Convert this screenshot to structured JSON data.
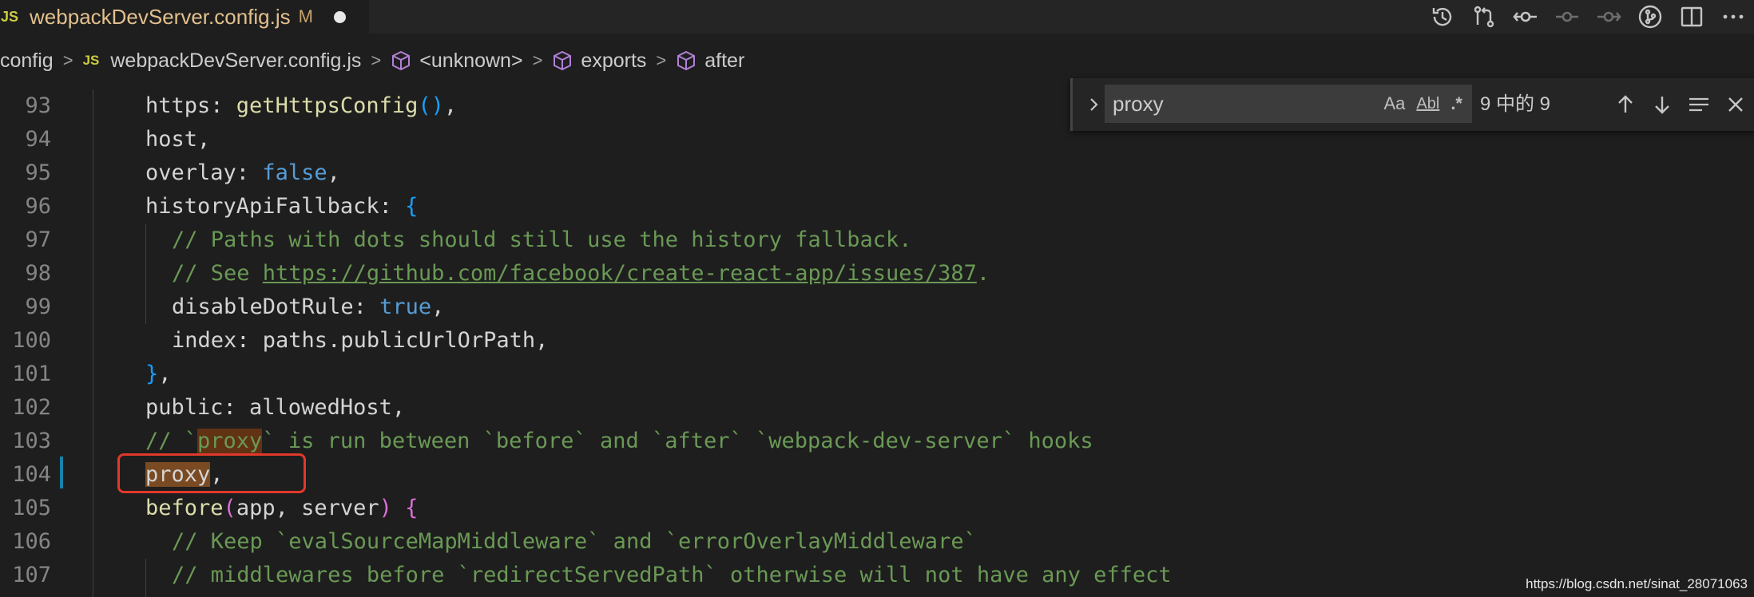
{
  "tab": {
    "lang_icon": "JS",
    "filename": "webpackDevServer.config.js",
    "status": "M"
  },
  "actions": [
    "history-icon",
    "compare-changes-icon",
    "git-commit-icon",
    "previous-change-icon",
    "next-change-icon",
    "git-graph-icon",
    "split-editor-icon",
    "more-actions-icon"
  ],
  "breadcrumb": {
    "folder": "config",
    "file_icon": "JS",
    "file": "webpackDevServer.config.js",
    "symbols": [
      "<unknown>",
      "exports",
      "after"
    ]
  },
  "find": {
    "query": "proxy",
    "match_case": "Aa",
    "whole_word": "Abl",
    "regex": ".*",
    "count": "9 中的 9"
  },
  "lines": [
    {
      "n": "93"
    },
    {
      "n": "94"
    },
    {
      "n": "95"
    },
    {
      "n": "96"
    },
    {
      "n": "97"
    },
    {
      "n": "98"
    },
    {
      "n": "99"
    },
    {
      "n": "100"
    },
    {
      "n": "101"
    },
    {
      "n": "102"
    },
    {
      "n": "103"
    },
    {
      "n": "104"
    },
    {
      "n": "105"
    },
    {
      "n": "106"
    },
    {
      "n": "107"
    }
  ],
  "code": {
    "l93": [
      "https",
      ": ",
      "getHttpsConfig",
      "()",
      ","
    ],
    "l94": "host,",
    "l95": [
      "overlay",
      ": ",
      "false",
      ","
    ],
    "l96": [
      "historyApiFallback",
      ": ",
      "{"
    ],
    "l97": "// Paths with dots should still use the history fallback.",
    "l98a": "// See ",
    "l98b": "https://github.com/facebook/create-react-app/issues/387",
    "l98c": ".",
    "l99": [
      "disableDotRule",
      ": ",
      "true",
      ","
    ],
    "l100": "index: paths.publicUrlOrPath,",
    "l101": [
      "}",
      ","
    ],
    "l102": "public: allowedHost,",
    "l103a": "// `",
    "l103b": "proxy",
    "l103c": "` is run between `before` and `after` `webpack-dev-server` hooks",
    "l104a": "proxy",
    "l104b": ",",
    "l105": [
      "before",
      "(",
      "app, server",
      ")",
      " ",
      "{"
    ],
    "l106": "// Keep `evalSourceMapMiddleware` and `errorOverlayMiddleware`",
    "l107": "// middlewares before `redirectServedPath` otherwise will not have any effect"
  },
  "watermark": "https://blog.csdn.net/sinat_28071063"
}
